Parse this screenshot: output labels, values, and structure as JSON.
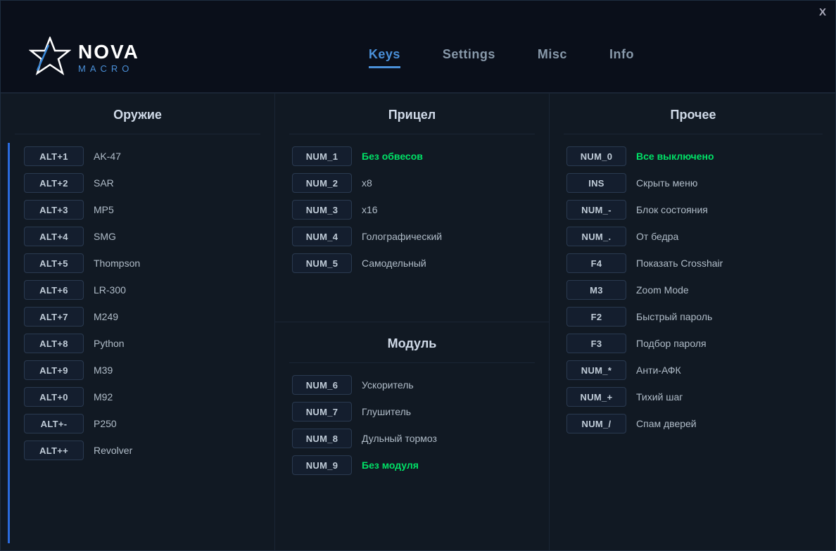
{
  "titleBar": {
    "closeLabel": "X"
  },
  "logo": {
    "nova": "NOVA",
    "macro": "MACRO"
  },
  "nav": {
    "tabs": [
      {
        "id": "keys",
        "label": "Keys",
        "active": true
      },
      {
        "id": "settings",
        "label": "Settings",
        "active": false
      },
      {
        "id": "misc",
        "label": "Misc",
        "active": false
      },
      {
        "id": "info",
        "label": "Info",
        "active": false
      }
    ]
  },
  "weapons": {
    "title": "Оружие",
    "items": [
      {
        "key": "ALT+1",
        "value": "AK-47"
      },
      {
        "key": "ALT+2",
        "value": "SAR"
      },
      {
        "key": "ALT+3",
        "value": "MP5"
      },
      {
        "key": "ALT+4",
        "value": "SMG"
      },
      {
        "key": "ALT+5",
        "value": "Thompson"
      },
      {
        "key": "ALT+6",
        "value": "LR-300"
      },
      {
        "key": "ALT+7",
        "value": "M249"
      },
      {
        "key": "ALT+8",
        "value": "Python"
      },
      {
        "key": "ALT+9",
        "value": "M39"
      },
      {
        "key": "ALT+0",
        "value": "M92"
      },
      {
        "key": "ALT+-",
        "value": "P250"
      },
      {
        "key": "ALT++",
        "value": "Revolver"
      }
    ]
  },
  "scope": {
    "title": "Прицел",
    "items": [
      {
        "key": "NUM_1",
        "value": "Без обвесов",
        "green": true
      },
      {
        "key": "NUM_2",
        "value": "x8"
      },
      {
        "key": "NUM_3",
        "value": "x16"
      },
      {
        "key": "NUM_4",
        "value": "Голографический"
      },
      {
        "key": "NUM_5",
        "value": "Самодельный"
      }
    ]
  },
  "module": {
    "title": "Модуль",
    "items": [
      {
        "key": "NUM_6",
        "value": "Ускоритель"
      },
      {
        "key": "NUM_7",
        "value": "Глушитель"
      },
      {
        "key": "NUM_8",
        "value": "Дульный тормоз"
      },
      {
        "key": "NUM_9",
        "value": "Без модуля",
        "green": true
      }
    ]
  },
  "other": {
    "title": "Прочее",
    "items": [
      {
        "key": "NUM_0",
        "value": "Все выключено",
        "green": true
      },
      {
        "key": "INS",
        "value": "Скрыть меню"
      },
      {
        "key": "NUM_-",
        "value": "Блок состояния"
      },
      {
        "key": "NUM_.",
        "value": "От бедра"
      },
      {
        "key": "F4",
        "value": "Показать Crosshair"
      },
      {
        "key": "M3",
        "value": "Zoom Mode"
      },
      {
        "key": "F2",
        "value": "Быстрый пароль"
      },
      {
        "key": "F3",
        "value": "Подбор пароля"
      },
      {
        "key": "NUM_*",
        "value": "Анти-АФК"
      },
      {
        "key": "NUM_+",
        "value": "Тихий шаг"
      },
      {
        "key": "NUM_/",
        "value": "Спам дверей"
      }
    ]
  }
}
